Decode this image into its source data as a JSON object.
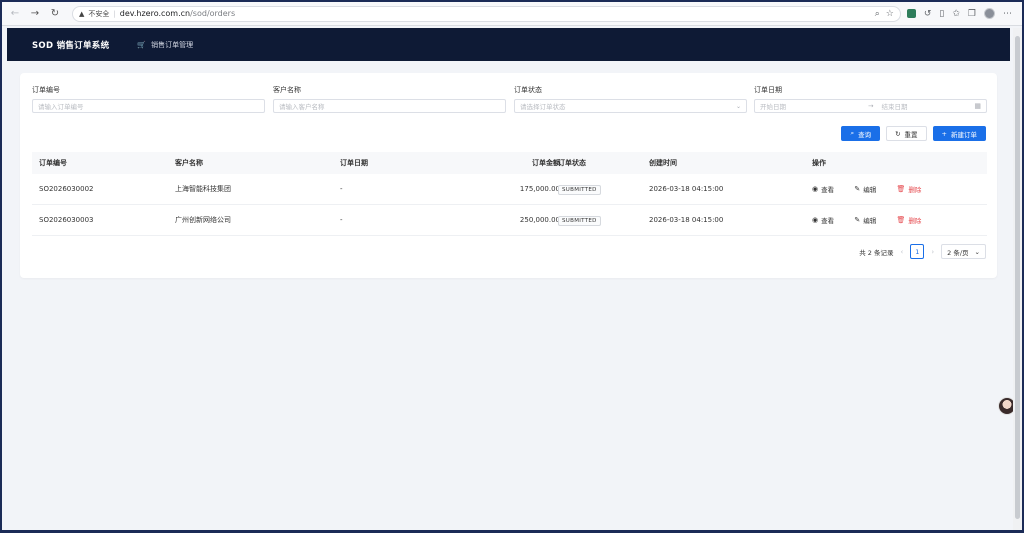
{
  "browser": {
    "security_label": "不安全",
    "url_host": "dev.hzero.com.cn",
    "url_path": "/sod/orders"
  },
  "app": {
    "logo": "SOD 销售订单系统",
    "breadcrumb": "销售订单管理"
  },
  "filters": {
    "order_no": {
      "label": "订单编号",
      "placeholder": "请输入订单编号"
    },
    "customer": {
      "label": "客户名称",
      "placeholder": "请输入客户名称"
    },
    "status": {
      "label": "订单状态",
      "placeholder": "请选择订单状态"
    },
    "date": {
      "label": "订单日期",
      "start_placeholder": "开始日期",
      "end_placeholder": "结束日期"
    }
  },
  "actions": {
    "search": "查询",
    "reset": "重置",
    "create": "新建订单"
  },
  "table": {
    "headers": [
      "订单编号",
      "客户名称",
      "订单日期",
      "订单金额",
      "订单状态",
      "创建时间",
      "操作"
    ],
    "rows": [
      {
        "order_no": "SO2026030002",
        "customer": "上海智能科技集团",
        "date": "-",
        "amount": "175,000.00",
        "status": "SUBMITTED",
        "created": "2026-03-18 04:15:00"
      },
      {
        "order_no": "SO2026030003",
        "customer": "广州创新网络公司",
        "date": "-",
        "amount": "250,000.00",
        "status": "SUBMITTED",
        "created": "2026-03-18 04:15:00"
      }
    ],
    "ops": {
      "view": "查看",
      "edit": "编辑",
      "delete": "删除"
    }
  },
  "pagination": {
    "total": "共 2 条记录",
    "current": "1",
    "page_size": "2 条/页"
  },
  "colors": {
    "header_bg": "#0e1a35",
    "primary": "#1a6fe8",
    "danger": "#e5484d"
  }
}
